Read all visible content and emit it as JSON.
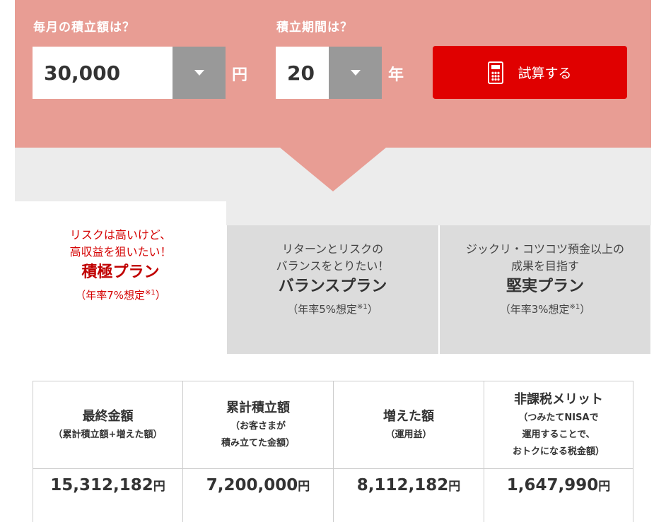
{
  "form": {
    "monthly_label": "毎月の積立額は？",
    "period_label": "積立期間は？",
    "monthly_value": "30,000",
    "monthly_unit": "円",
    "period_value": "20",
    "period_unit": "年",
    "calc_button": "試算する"
  },
  "plans": [
    {
      "desc1": "リスクは高いけど、",
      "desc2": "高収益を狙いたい！",
      "name": "積極プラン",
      "rate": "（年率7%想定",
      "note": "※1",
      "close": "）"
    },
    {
      "desc1": "リターンとリスクの",
      "desc2": "バランスをとりたい！",
      "name": "バランスプラン",
      "rate": "（年率5%想定",
      "note": "※1",
      "close": "）"
    },
    {
      "desc1": "ジックリ・コツコツ預金以上の",
      "desc2": "成果を目指す",
      "name": "堅実プラン",
      "rate": "（年率3%想定",
      "note": "※1",
      "close": "）"
    }
  ],
  "results": {
    "headers": [
      {
        "title": "最終金額",
        "sub": [
          "（累計積立額+増えた額）"
        ]
      },
      {
        "title": "累計積立額",
        "sub": [
          "（お客さまが",
          "積み立てた金額）"
        ]
      },
      {
        "title": "増えた額",
        "sub": [
          "（運用益）"
        ]
      },
      {
        "title": "非課税メリット",
        "sub": [
          "（つみたてNISAで",
          "運用することで、",
          "おトクになる税金額）"
        ]
      }
    ],
    "values": [
      {
        "amount": "15,312,182",
        "unit": "円"
      },
      {
        "amount": "7,200,000",
        "unit": "円"
      },
      {
        "amount": "8,112,182",
        "unit": "円"
      },
      {
        "amount": "1,647,990",
        "unit": "円"
      }
    ]
  },
  "colors": {
    "panel": "#e89d94",
    "button": "#e00000",
    "active_plan_text": "#d40000",
    "inactive_plan_bg": "#dcdcdc"
  }
}
